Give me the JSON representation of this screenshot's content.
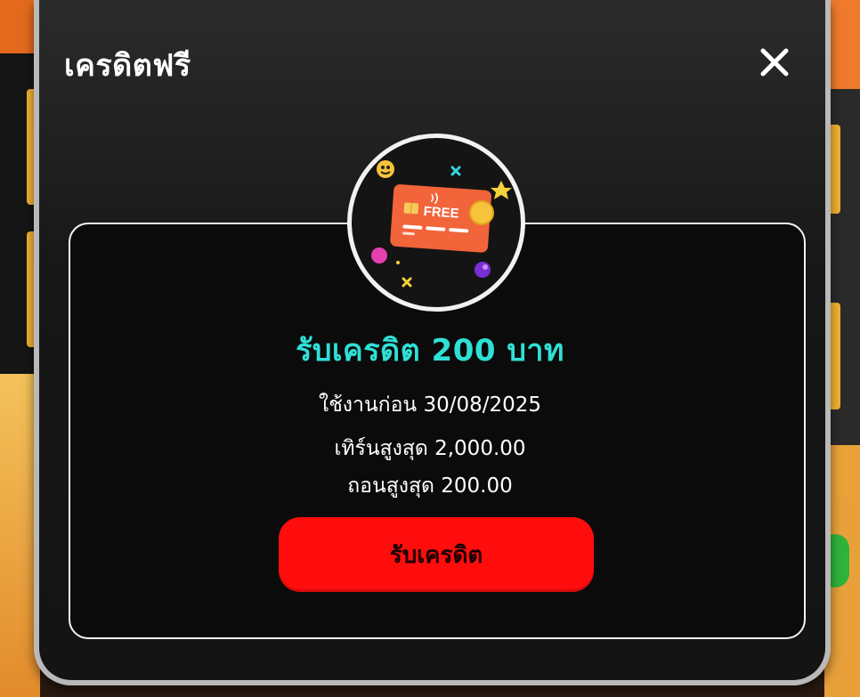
{
  "modal": {
    "title": "เครดิตฟรี",
    "close_icon": "close-icon"
  },
  "badge": {
    "icon": "free-credit-card-icon",
    "card_text": "FREE"
  },
  "offer": {
    "headline": "รับเครดิต 200 บาท",
    "expiry": "ใช้งานก่อน 30/08/2025",
    "max_turnover": "เทิร์นสูงสุด 2,000.00",
    "max_withdraw": "ถอนสูงสุด 200.00"
  },
  "actions": {
    "claim_label": "รับเครดิต"
  },
  "colors": {
    "accent_teal": "#2fe0d6",
    "button_red": "#ff0d0d",
    "card_orange": "#f2643a",
    "border": "#f3f3f3"
  }
}
